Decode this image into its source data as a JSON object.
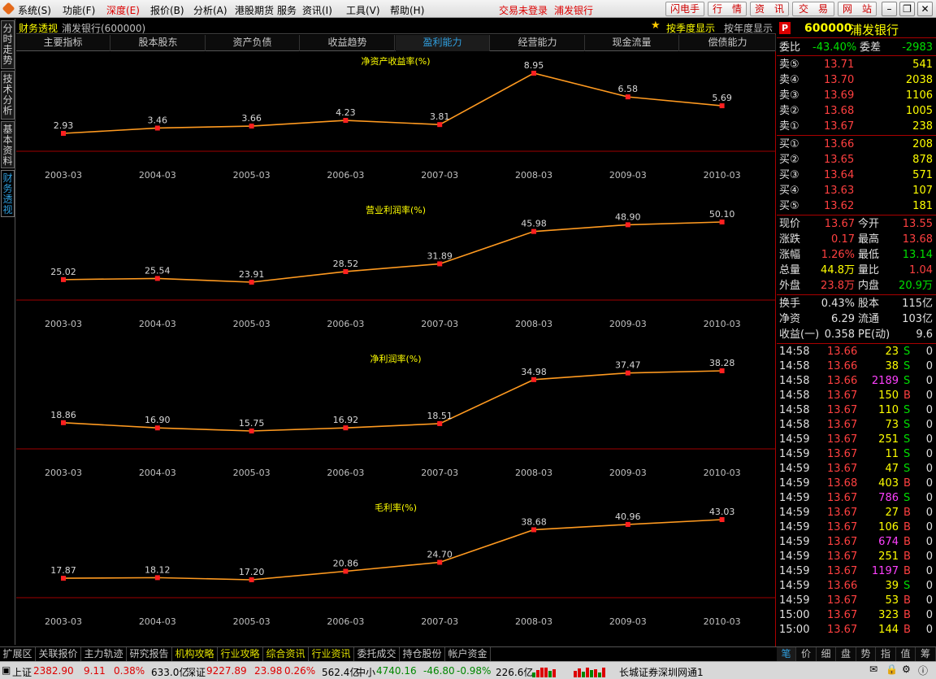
{
  "menu": {
    "items": [
      "系统(S)",
      "功能(F)",
      "深度(E)",
      "报价(B)",
      "分析(A)",
      "港股期货",
      "服务",
      "资讯(I)",
      "工具(V)",
      "帮助(H)"
    ],
    "login_status": "交易未登录",
    "stock_name": "浦发银行",
    "tool_buttons": [
      "闪电手",
      "行　情",
      "资　讯",
      "交　易",
      "网　站"
    ]
  },
  "left_tabs": [
    "分时走势",
    "技术分析",
    "基本资料",
    "财务透视"
  ],
  "title": {
    "section": "财务透视",
    "stock": "浦发银行(600000)",
    "opt_quarter": "按季度显示",
    "opt_year": "按年度显示"
  },
  "subtabs": [
    "主要指标",
    "股本股东",
    "资产负债",
    "收益趋势",
    "盈利能力",
    "经营能力",
    "现金流量",
    "偿债能力"
  ],
  "colors": {
    "line": "#ff9a20",
    "marker": "#ff2020",
    "axis": "#a00000",
    "title": "#ffff00"
  },
  "chart_data": [
    {
      "type": "line",
      "title": "净资产收益率(%)",
      "categories": [
        "2003-03",
        "2004-03",
        "2005-03",
        "2006-03",
        "2007-03",
        "2008-03",
        "2009-03",
        "2010-03"
      ],
      "values": [
        2.93,
        3.46,
        3.66,
        4.23,
        3.81,
        8.95,
        6.58,
        5.69
      ]
    },
    {
      "type": "line",
      "title": "营业利润率(%)",
      "categories": [
        "2003-03",
        "2004-03",
        "2005-03",
        "2006-03",
        "2007-03",
        "2008-03",
        "2009-03",
        "2010-03"
      ],
      "values": [
        25.02,
        25.54,
        23.91,
        28.52,
        31.89,
        45.98,
        48.9,
        50.1
      ]
    },
    {
      "type": "line",
      "title": "净利润率(%)",
      "categories": [
        "2003-03",
        "2004-03",
        "2005-03",
        "2006-03",
        "2007-03",
        "2008-03",
        "2009-03",
        "2010-03"
      ],
      "values": [
        18.86,
        16.9,
        15.75,
        16.92,
        18.51,
        34.98,
        37.47,
        38.28
      ]
    },
    {
      "type": "line",
      "title": "毛利率(%)",
      "categories": [
        "2003-03",
        "2004-03",
        "2005-03",
        "2006-03",
        "2007-03",
        "2008-03",
        "2009-03",
        "2010-03"
      ],
      "values": [
        17.87,
        18.12,
        17.2,
        20.86,
        24.7,
        38.68,
        40.96,
        43.03
      ]
    }
  ],
  "quote": {
    "code": "600000",
    "name": "浦发银行",
    "weibi_label": "委比",
    "weibi": "-43.40%",
    "weicha_label": "委差",
    "weicha": "-2983",
    "sells": [
      {
        "label": "卖⑤",
        "price": "13.71",
        "vol": "541"
      },
      {
        "label": "卖④",
        "price": "13.70",
        "vol": "2038"
      },
      {
        "label": "卖③",
        "price": "13.69",
        "vol": "1106"
      },
      {
        "label": "卖②",
        "price": "13.68",
        "vol": "1005"
      },
      {
        "label": "卖①",
        "price": "13.67",
        "vol": "238"
      }
    ],
    "buys": [
      {
        "label": "买①",
        "price": "13.66",
        "vol": "208"
      },
      {
        "label": "买②",
        "price": "13.65",
        "vol": "878"
      },
      {
        "label": "买③",
        "price": "13.64",
        "vol": "571"
      },
      {
        "label": "买④",
        "price": "13.63",
        "vol": "107"
      },
      {
        "label": "买⑤",
        "price": "13.62",
        "vol": "181"
      }
    ],
    "stats": [
      {
        "l1": "现价",
        "v1": "13.67",
        "c1": "red",
        "l2": "今开",
        "v2": "13.55",
        "c2": "red"
      },
      {
        "l1": "涨跌",
        "v1": "0.17",
        "c1": "red",
        "l2": "最高",
        "v2": "13.68",
        "c2": "red"
      },
      {
        "l1": "涨幅",
        "v1": "1.26%",
        "c1": "red",
        "l2": "最低",
        "v2": "13.14",
        "c2": "green"
      },
      {
        "l1": "总量",
        "v1": "44.8万",
        "c1": "yellow",
        "l2": "量比",
        "v2": "1.04",
        "c2": "red"
      },
      {
        "l1": "外盘",
        "v1": "23.8万",
        "c1": "red",
        "l2": "内盘",
        "v2": "20.9万",
        "c2": "green"
      }
    ],
    "stats2": [
      {
        "l1": "换手",
        "v1": "0.43%",
        "l2": "股本",
        "v2": "115亿"
      },
      {
        "l1": "净资",
        "v1": "6.29",
        "l2": "流通",
        "v2": "103亿"
      },
      {
        "l1": "收益(一)",
        "v1": "0.358",
        "l2": "PE(动)",
        "v2": "9.6"
      }
    ],
    "ticks": [
      {
        "t": "14:58",
        "p": "13.66",
        "pc": "red",
        "v": "23",
        "vc": "yellow",
        "d": "S",
        "n": "0"
      },
      {
        "t": "14:58",
        "p": "13.66",
        "pc": "red",
        "v": "38",
        "vc": "yellow",
        "d": "S",
        "n": "0"
      },
      {
        "t": "14:58",
        "p": "13.66",
        "pc": "red",
        "v": "2189",
        "vc": "magenta",
        "d": "S",
        "n": "0"
      },
      {
        "t": "14:58",
        "p": "13.67",
        "pc": "red",
        "v": "150",
        "vc": "yellow",
        "d": "B",
        "n": "0"
      },
      {
        "t": "14:58",
        "p": "13.67",
        "pc": "red",
        "v": "110",
        "vc": "yellow",
        "d": "S",
        "n": "0"
      },
      {
        "t": "14:58",
        "p": "13.67",
        "pc": "red",
        "v": "73",
        "vc": "yellow",
        "d": "S",
        "n": "0"
      },
      {
        "t": "14:59",
        "p": "13.67",
        "pc": "red",
        "v": "251",
        "vc": "yellow",
        "d": "S",
        "n": "0"
      },
      {
        "t": "14:59",
        "p": "13.67",
        "pc": "red",
        "v": "11",
        "vc": "yellow",
        "d": "S",
        "n": "0"
      },
      {
        "t": "14:59",
        "p": "13.67",
        "pc": "red",
        "v": "47",
        "vc": "yellow",
        "d": "S",
        "n": "0"
      },
      {
        "t": "14:59",
        "p": "13.68",
        "pc": "red",
        "v": "403",
        "vc": "yellow",
        "d": "B",
        "n": "0"
      },
      {
        "t": "14:59",
        "p": "13.67",
        "pc": "red",
        "v": "786",
        "vc": "magenta",
        "d": "S",
        "n": "0"
      },
      {
        "t": "14:59",
        "p": "13.67",
        "pc": "red",
        "v": "27",
        "vc": "yellow",
        "d": "B",
        "n": "0"
      },
      {
        "t": "14:59",
        "p": "13.67",
        "pc": "red",
        "v": "106",
        "vc": "yellow",
        "d": "B",
        "n": "0"
      },
      {
        "t": "14:59",
        "p": "13.67",
        "pc": "red",
        "v": "674",
        "vc": "magenta",
        "d": "B",
        "n": "0"
      },
      {
        "t": "14:59",
        "p": "13.67",
        "pc": "red",
        "v": "251",
        "vc": "yellow",
        "d": "B",
        "n": "0"
      },
      {
        "t": "14:59",
        "p": "13.67",
        "pc": "red",
        "v": "1197",
        "vc": "magenta",
        "d": "B",
        "n": "0"
      },
      {
        "t": "14:59",
        "p": "13.66",
        "pc": "red",
        "v": "39",
        "vc": "yellow",
        "d": "S",
        "n": "0"
      },
      {
        "t": "14:59",
        "p": "13.67",
        "pc": "red",
        "v": "53",
        "vc": "yellow",
        "d": "B",
        "n": "0"
      },
      {
        "t": "15:00",
        "p": "13.67",
        "pc": "red",
        "v": "323",
        "vc": "yellow",
        "d": "B",
        "n": "0"
      },
      {
        "t": "15:00",
        "p": "13.67",
        "pc": "red",
        "v": "144",
        "vc": "yellow",
        "d": "B",
        "n": "0"
      }
    ],
    "tabs": [
      "笔",
      "价",
      "细",
      "盘",
      "势",
      "指",
      "值",
      "筹"
    ]
  },
  "bottom_tabs": [
    {
      "label": "扩展区",
      "c": "grey"
    },
    {
      "label": "关联报价",
      "c": "grey"
    },
    {
      "label": "主力轨迹",
      "c": "grey"
    },
    {
      "label": "研究报告",
      "c": "grey"
    },
    {
      "label": "机构攻略",
      "c": "yellow"
    },
    {
      "label": "行业攻略",
      "c": "yellow"
    },
    {
      "label": "综合资讯",
      "c": "yellow"
    },
    {
      "label": "行业资讯",
      "c": "yellow"
    },
    {
      "label": "委托成交",
      "c": "grey"
    },
    {
      "label": "持仓股份",
      "c": "grey"
    },
    {
      "label": "帐户资金",
      "c": "grey"
    }
  ],
  "status": {
    "sh_label": "上证",
    "sh_val": "2382.90",
    "sh_chg": "9.11",
    "sh_pct": "0.38%",
    "sh_amt": "633.0亿",
    "sz_label": "深证",
    "sz_val": "9227.89",
    "sz_chg": "23.98",
    "sz_pct": "0.26%",
    "sz_amt": "562.4亿",
    "zx_label": "中小",
    "zx_val": "4740.16",
    "zx_chg": "-46.80",
    "zx_pct": "-0.98%",
    "zx_amt": "226.6亿",
    "broker": "长城证券深圳网通1"
  }
}
